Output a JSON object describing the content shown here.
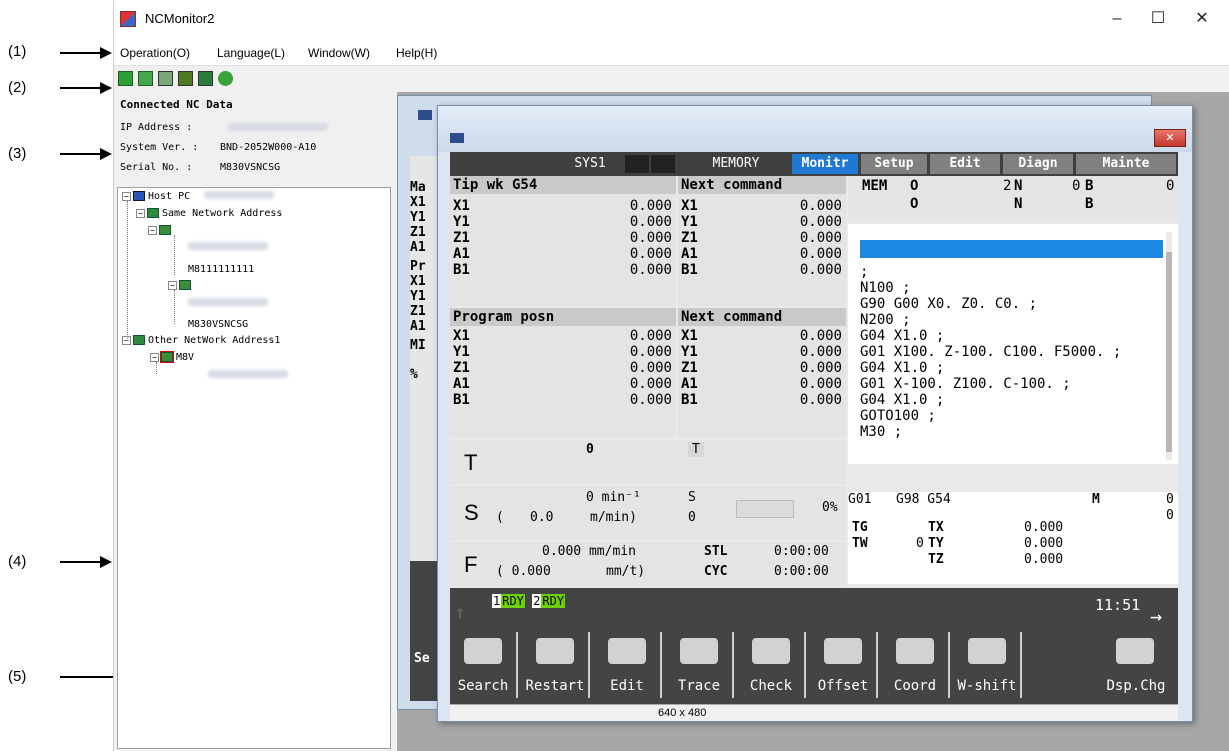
{
  "annotations": [
    "(1)",
    "(2)",
    "(3)",
    "(4)",
    "(5)"
  ],
  "app": {
    "title": "NCMonitor2",
    "controls": {
      "minimize": "–",
      "maximize": "☐",
      "close": "✕"
    },
    "menu": [
      "Operation(O)",
      "Language(L)",
      "Window(W)",
      "Help(H)"
    ]
  },
  "info": {
    "header": "Connected NC Data",
    "ip_label": "IP Address  :",
    "sysver_label": "System Ver. :",
    "sysver_value": "BND-2052W000-A10",
    "serial_label": "Serial No.  :",
    "serial_value": "M830VSNCSG"
  },
  "tree": {
    "host": "Host PC",
    "same_net": "Same Network Address",
    "nc1": "M8111111111",
    "nc2": "M830VSNCSG",
    "other_net": "Other NetWork Address1",
    "nc3": "M8V"
  },
  "nc": {
    "system": "SYS1",
    "mode": "MEMORY",
    "tabs": [
      "Monitr",
      "Setup",
      "Edit",
      "Diagn",
      "Mainte"
    ],
    "mem": {
      "label": "MEM",
      "o": "O",
      "o2": "O",
      "n_val": "2",
      "n": "N",
      "n2": "N",
      "b_pre": "0",
      "b": "B",
      "b2": "B",
      "b_val": "0"
    },
    "tip_header": "Tip wk G54",
    "next_header": "Next command",
    "prog_header": "Program posn",
    "next_header2": "Next command",
    "axes": [
      "X1",
      "Y1",
      "Z1",
      "A1",
      "B1"
    ],
    "zero": "0.000",
    "program": [
      ";",
      "N100 ;",
      "G90 G00 X0. Z0. C0. ;",
      "N200 ;",
      "G04 X1.0 ;",
      "G01 X100. Z-100. C100. F5000. ;",
      "G04 X1.0 ;",
      "G01 X-100. Z100. C-100. ;",
      "G04 X1.0 ;",
      "GOTO100 ;",
      "M30 ;"
    ],
    "t": {
      "label": "T",
      "value": "0",
      "tag": "T"
    },
    "s": {
      "label": "S",
      "rpm": "0 min⁻¹",
      "paren": "(",
      "mmin": "0.0",
      "unit": "m/min)",
      "tag": "S",
      "val": "0",
      "pct": "0%"
    },
    "f": {
      "label": "F",
      "feed": "0.000 mm/min",
      "paren": "( 0.000",
      "unit": "mm/t)",
      "stl": "STL",
      "stl_t": "0:00:00",
      "cyc": "CYC",
      "cyc_t": "0:00:00"
    },
    "modal": {
      "g1": "G01",
      "g2": "G98 G54",
      "m": "M",
      "m1": "0",
      "m2": "0",
      "tg": "TG",
      "tw": "TW",
      "tw_val": "0",
      "tx": "TX",
      "ty": "TY",
      "tz": "TZ"
    },
    "rdy": {
      "one": "1",
      "two": "2",
      "text": "RDY"
    },
    "clock": "11:51",
    "softkeys": [
      "Search",
      "Restart",
      "Edit",
      "Trace",
      "Check",
      "Offset",
      "Coord",
      "W-shift",
      "Dsp.Chg"
    ],
    "status_size": "640 x 480"
  },
  "back": {
    "axis": [
      "Ma",
      "X1",
      "Y1",
      "Z1",
      "A1",
      "Pr",
      "X1",
      "Y1",
      "Z1",
      "A1",
      "MI"
    ],
    "pct": "%",
    "se": "Se"
  }
}
